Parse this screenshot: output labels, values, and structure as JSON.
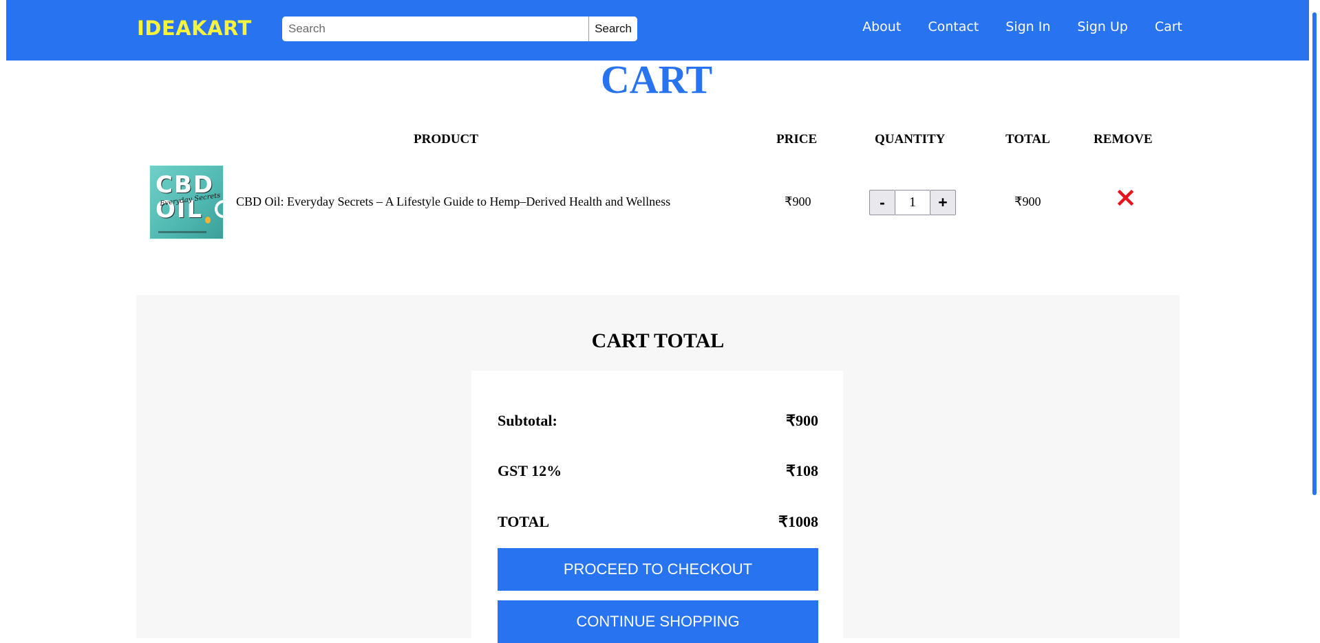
{
  "header": {
    "brand": "IDEAKART",
    "search": {
      "placeholder": "Search",
      "value": "",
      "button_label": "Search"
    },
    "nav": [
      "About",
      "Contact",
      "Sign In",
      "Sign Up",
      "Cart"
    ]
  },
  "page": {
    "title": "CART"
  },
  "table": {
    "columns": {
      "product": "PRODUCT",
      "price": "PRICE",
      "quantity": "QUANTITY",
      "total": "TOTAL",
      "remove": "REMOVE"
    },
    "items": [
      {
        "name": "CBD Oil: Everyday Secrets – A Lifestyle Guide to Hemp–Derived Health and Wellness",
        "cover": {
          "line1": "CBD",
          "line2": "OIL",
          "script": "Everyday Secrets"
        },
        "price": "₹900",
        "quantity": "1",
        "total": "₹900",
        "decrement_label": "-",
        "increment_label": "+",
        "remove_icon": "close-x-icon"
      }
    ]
  },
  "totals": {
    "title": "CART TOTAL",
    "subtotal_label": "Subtotal:",
    "subtotal_value": "₹900",
    "gst_label": "GST 12%",
    "gst_value": "₹108",
    "total_label": "TOTAL",
    "total_value": "₹1008",
    "checkout_label": "PROCEED TO CHECKOUT",
    "continue_label": "CONTINUE SHOPPING"
  },
  "colors": {
    "primary": "#2873ef",
    "brand": "#f7f23a",
    "remove": "#e8141c",
    "section_bg": "#f7f7f7"
  }
}
